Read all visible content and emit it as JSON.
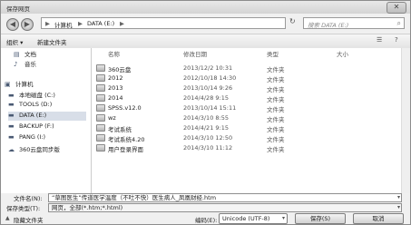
{
  "window": {
    "title": "保存网页",
    "close_glyph": "✕"
  },
  "address": {
    "back_glyph": "◀",
    "forward_glyph": "▶",
    "segments": [
      "▶",
      "计算机",
      "▶",
      "DATA (E:)",
      "▶"
    ],
    "refresh_glyph": "↻",
    "search_placeholder": "搜索 DATA (E:)"
  },
  "toolbar": {
    "organize_label": "组织 ▾",
    "new_folder_label": "新建文件夹",
    "view_glyph": "☰",
    "help_glyph": "?"
  },
  "nav": {
    "items": [
      {
        "label": "文档",
        "icon": "document-icon"
      },
      {
        "label": "音乐",
        "icon": "music-icon"
      },
      {
        "label": "计算机",
        "icon": "computer-icon"
      },
      {
        "label": "本地磁盘 (C:)",
        "icon": "drive-icon"
      },
      {
        "label": "TOOLS (D:)",
        "icon": "drive-icon"
      },
      {
        "label": "DATA (E:)",
        "icon": "drive-icon"
      },
      {
        "label": "BACKUP (F:)",
        "icon": "drive-icon"
      },
      {
        "label": "PANG (I:)",
        "icon": "drive-icon"
      },
      {
        "label": "360云盘同步版",
        "icon": "cloud-icon"
      }
    ]
  },
  "files": {
    "headers": {
      "name": "名称",
      "date": "修改日期",
      "type": "类型",
      "size": "大小"
    },
    "rows": [
      {
        "name": "360云盘",
        "date": "2013/12/2 10:31",
        "type": "文件夹"
      },
      {
        "name": "2012",
        "date": "2012/10/18 14:30",
        "type": "文件夹"
      },
      {
        "name": "2013",
        "date": "2013/10/14 9:26",
        "type": "文件夹"
      },
      {
        "name": "2014",
        "date": "2014/4/28 9:15",
        "type": "文件夹"
      },
      {
        "name": "SPSS.v12.0",
        "date": "2013/10/14 15:11",
        "type": "文件夹"
      },
      {
        "name": "wz",
        "date": "2014/3/10 8:55",
        "type": "文件夹"
      },
      {
        "name": "考试系统",
        "date": "2014/4/21 9:15",
        "type": "文件夹"
      },
      {
        "name": "考试系统4.20",
        "date": "2014/3/10 12:50",
        "type": "文件夹"
      },
      {
        "name": "用户登录界面",
        "date": "2014/3/10 11:12",
        "type": "文件夹"
      }
    ]
  },
  "form": {
    "filename_label": "文件名(N):",
    "filename_value": "“草图医生”传道医学温度（不吐不快）医生病人_凤凰财经.htm",
    "filetype_label": "保存类型(T):",
    "filetype_value": "网页，全部(*.htm;*.html)",
    "dropdown_glyph": "▾"
  },
  "footer": {
    "hide_folders_label": "隐藏文件夹",
    "encoding_label": "编码(E):",
    "encoding_value": "Unicode (UTF-8)",
    "save_label": "保存(S)",
    "cancel_label": "取消"
  }
}
